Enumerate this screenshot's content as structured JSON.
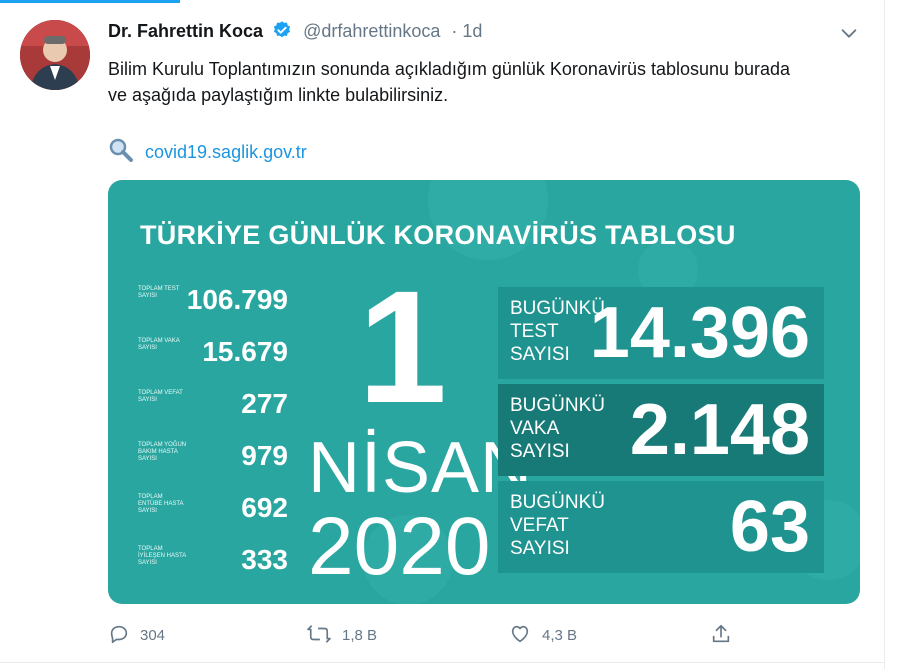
{
  "tweet": {
    "author_name": "Dr. Fahrettin Koca",
    "handle": "@drfahrettinkoca",
    "time": "· 1d",
    "text": "Bilim Kurulu Toplantımızın sonunda açıkladığım günlük Koronavirüs tablosunu burada ve aşağıda paylaştığım linkte bulabilirsiniz.",
    "link": "covid19.saglik.gov.tr",
    "icons": {
      "verified": "verified-badge-icon",
      "menu": "chevron-down-icon",
      "link": "magnifier-icon"
    },
    "colors": {
      "accent": "#1da1f2",
      "link": "#1b95e0",
      "card_bg": "#2aa6a1"
    }
  },
  "card": {
    "title": "TÜRKİYE GÜNLÜK KORONAVİRÜS TABLOSU",
    "stats": [
      {
        "label": "TOPLAM TEST SAYISI",
        "value": "106.799"
      },
      {
        "label": "TOPLAM VAKA SAYISI",
        "value": "15.679"
      },
      {
        "label": "TOPLAM VEFAT SAYISI",
        "value": "277"
      },
      {
        "label": "TOPLAM YOĞUN BAKIM HASTA SAYISI",
        "value": "979"
      },
      {
        "label": "TOPLAM ENTÜBE HASTA SAYISI",
        "value": "692"
      },
      {
        "label": "TOPLAM İYİLEŞEN HASTA SAYISI",
        "value": "333"
      }
    ],
    "date": {
      "day": "1",
      "month": "NİSAN",
      "year": "2020"
    },
    "today": [
      {
        "label": "BUGÜNKÜ TEST SAYISI",
        "value": "14.396"
      },
      {
        "label": "BUGÜNKÜ VAKA SAYISI",
        "value": "2.148"
      },
      {
        "label": "BUGÜNKÜ VEFAT SAYISI",
        "value": "63"
      }
    ]
  },
  "actions": {
    "reply": {
      "icon": "reply-icon",
      "count": "304"
    },
    "retweet": {
      "icon": "retweet-icon",
      "count": "1,8 B"
    },
    "like": {
      "icon": "heart-icon",
      "count": "4,3 B"
    },
    "share": {
      "icon": "share-icon"
    }
  }
}
